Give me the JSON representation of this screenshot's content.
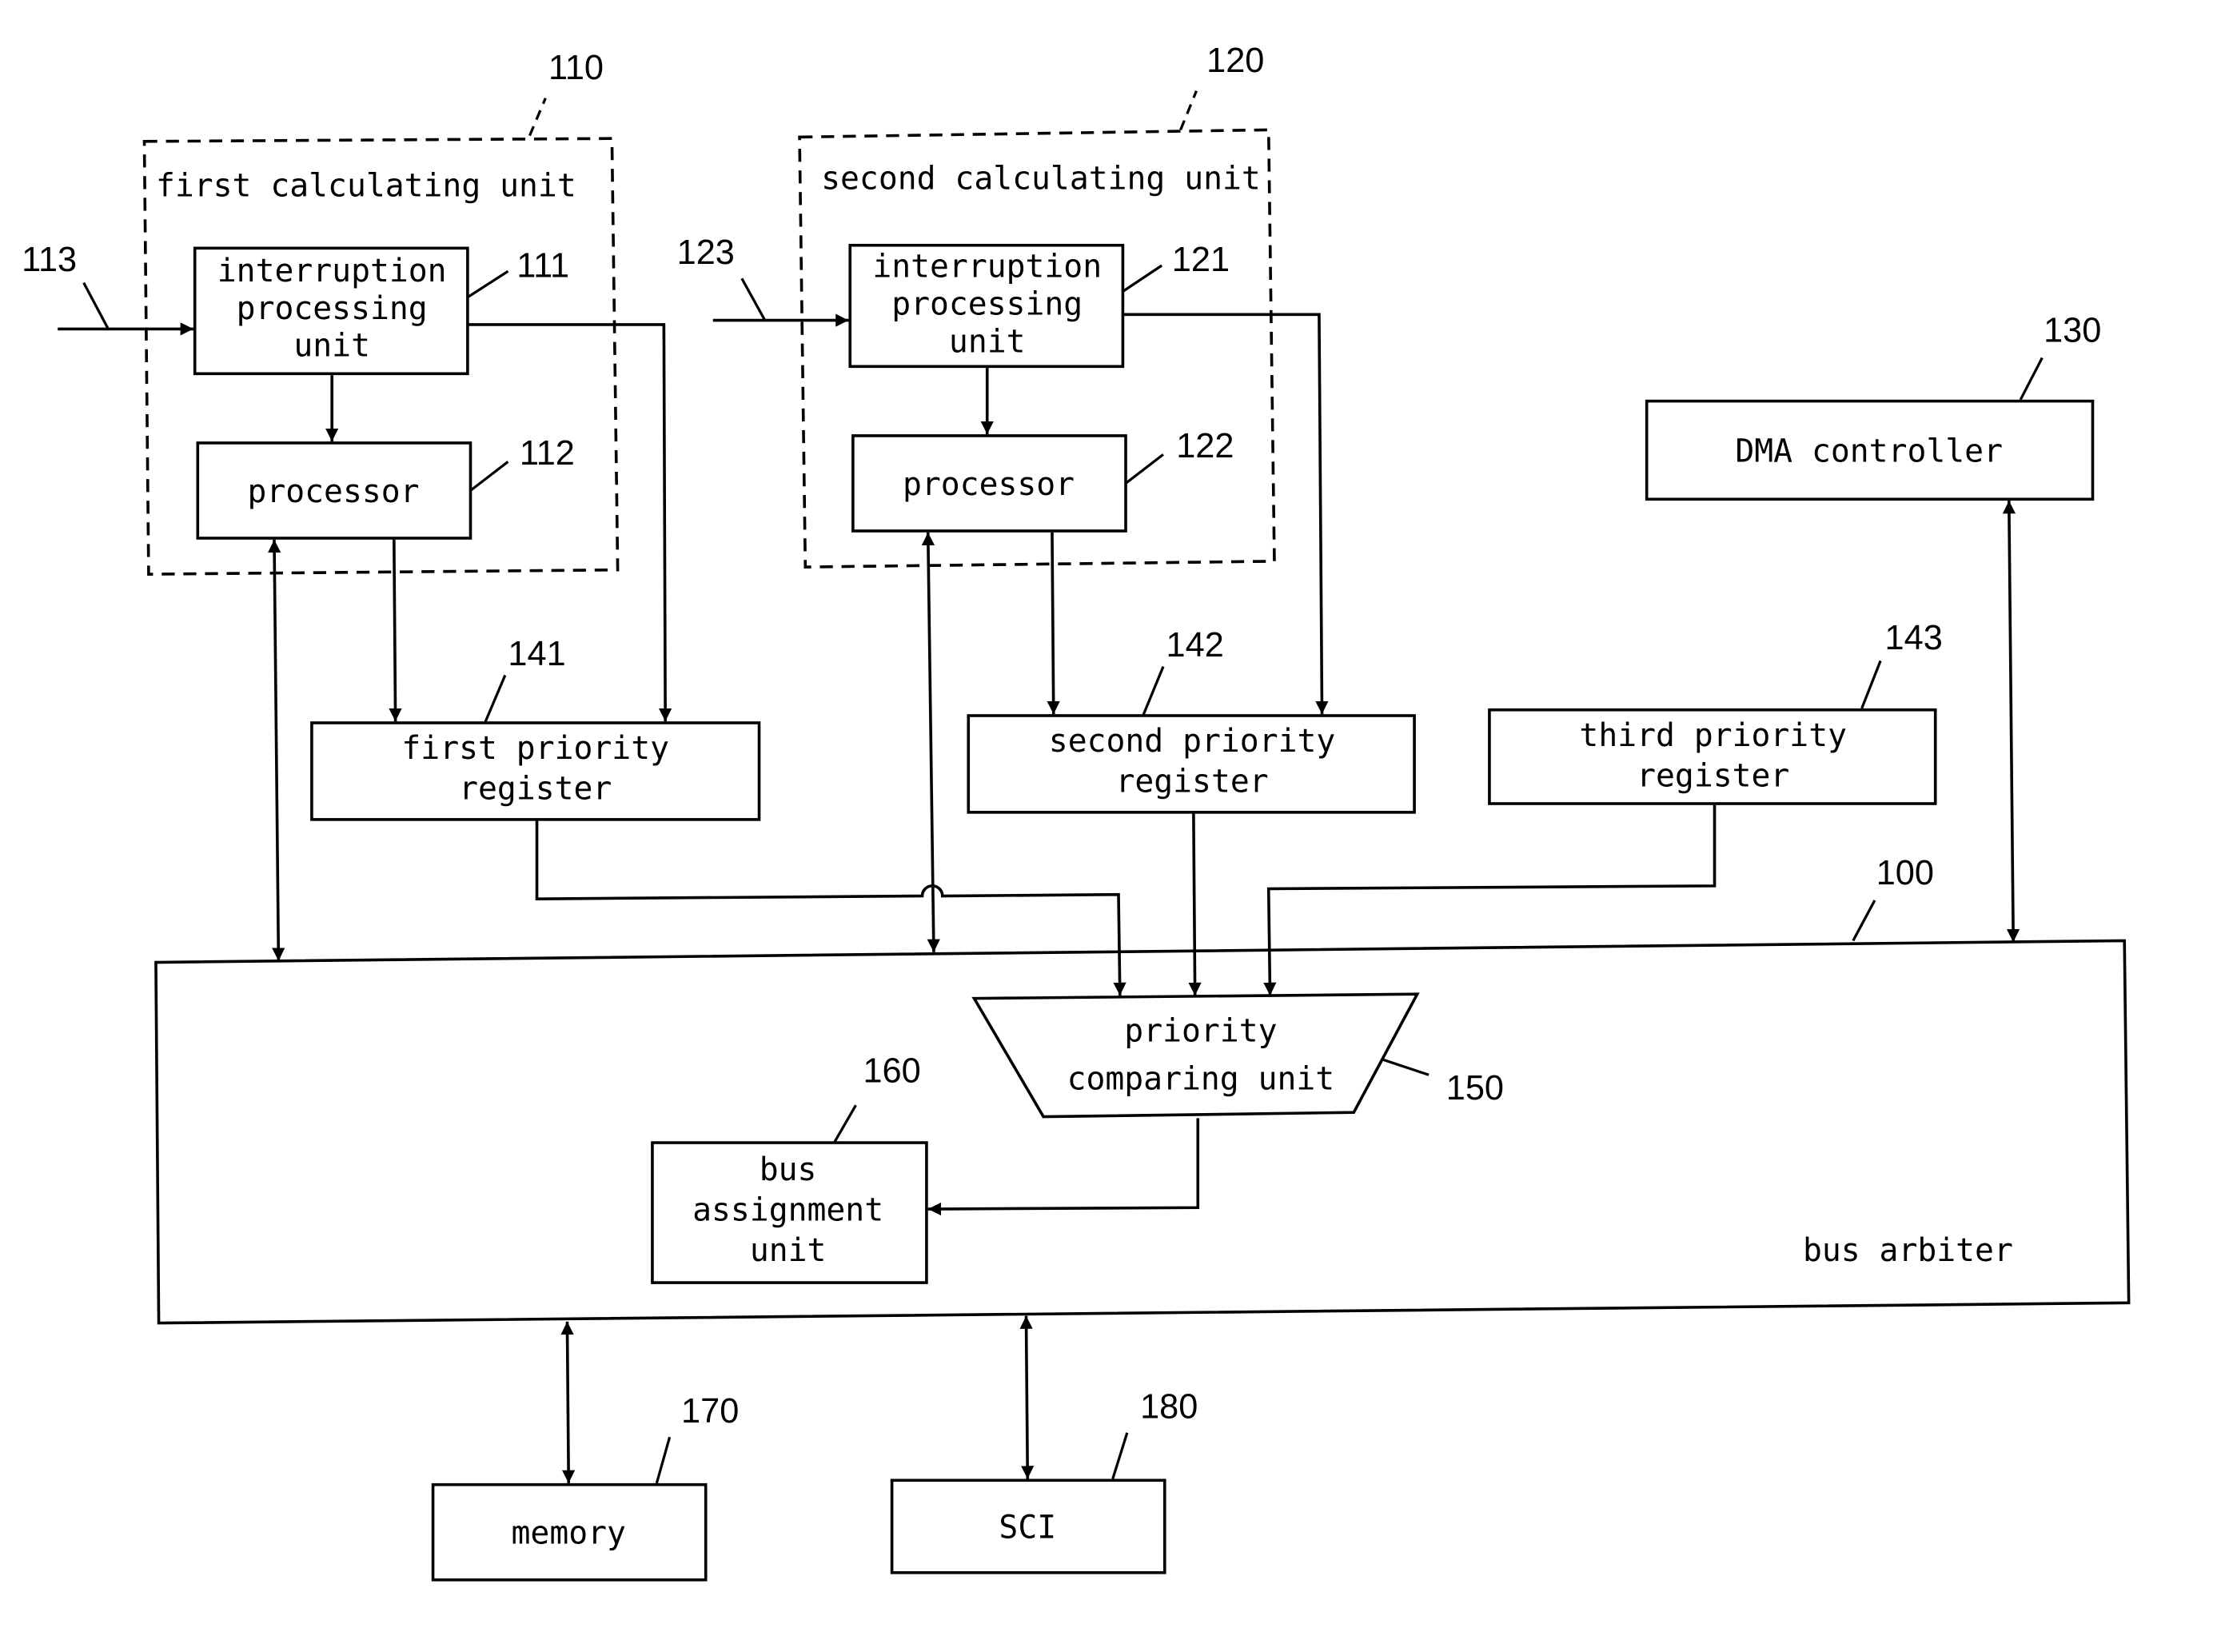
{
  "diagram": {
    "units": {
      "first_calc": {
        "ref": "110",
        "title": "first calculating unit"
      },
      "second_calc": {
        "ref": "120",
        "title": "second calculating unit"
      }
    },
    "blocks": {
      "ipu1": {
        "ref": "111",
        "lines": [
          "interruption",
          "processing",
          "unit"
        ]
      },
      "proc1": {
        "ref": "112",
        "lines": [
          "processor"
        ]
      },
      "ipu2": {
        "ref": "121",
        "lines": [
          "interruption",
          "processing",
          "unit"
        ]
      },
      "proc2": {
        "ref": "122",
        "lines": [
          "processor"
        ]
      },
      "dma": {
        "ref": "130",
        "lines": [
          "DMA controller"
        ]
      },
      "reg1": {
        "ref": "141",
        "lines": [
          "first priority",
          "register"
        ]
      },
      "reg2": {
        "ref": "142",
        "lines": [
          "second priority",
          "register"
        ]
      },
      "reg3": {
        "ref": "143",
        "lines": [
          "third priority",
          "register"
        ]
      },
      "arbiter": {
        "ref": "100",
        "lines": [
          "bus arbiter"
        ]
      },
      "comparer": {
        "ref": "150",
        "lines": [
          "priority",
          "comparing unit"
        ]
      },
      "assign": {
        "ref": "160",
        "lines": [
          "bus",
          "assignment",
          "unit"
        ]
      },
      "memory": {
        "ref": "170",
        "lines": [
          "memory"
        ]
      },
      "sci": {
        "ref": "180",
        "lines": [
          "SCI"
        ]
      }
    },
    "signals": {
      "in1": {
        "ref": "113"
      },
      "in2": {
        "ref": "123"
      }
    }
  }
}
